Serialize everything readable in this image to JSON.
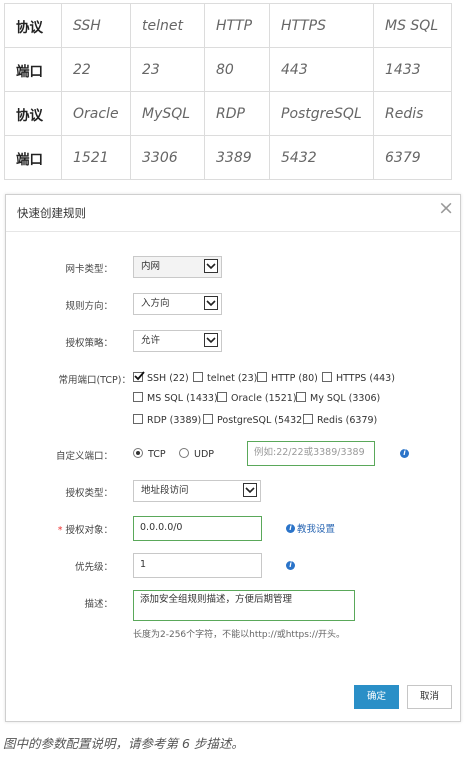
{
  "port_table": {
    "rows": [
      {
        "header": "协议",
        "cells": [
          "SSH",
          "telnet",
          "HTTP",
          "HTTPS",
          "MS SQL"
        ]
      },
      {
        "header": "端口",
        "cells": [
          "22",
          "23",
          "80",
          "443",
          "1433"
        ]
      },
      {
        "header": "协议",
        "cells": [
          "Oracle",
          "MySQL",
          "RDP",
          "PostgreSQL",
          "Redis"
        ]
      },
      {
        "header": "端口",
        "cells": [
          "1521",
          "3306",
          "3389",
          "5432",
          "6379"
        ]
      }
    ]
  },
  "dialog": {
    "title": "快速创建规则",
    "close_glyph": "×",
    "nic_type": {
      "label": "网卡类型：",
      "value": "内网"
    },
    "direction": {
      "label": "规则方向：",
      "value": "入方向"
    },
    "policy": {
      "label": "授权策略：",
      "value": "允许"
    },
    "common_ports": {
      "label": "常用端口(TCP)：",
      "options": [
        {
          "label": "SSH (22)",
          "checked": true
        },
        {
          "label": "telnet (23)",
          "checked": false
        },
        {
          "label": "HTTP (80)",
          "checked": false
        },
        {
          "label": "HTTPS (443)",
          "checked": false
        },
        {
          "label": "MS SQL (1433)",
          "checked": false
        },
        {
          "label": "Oracle (1521)",
          "checked": false
        },
        {
          "label": "My SQL (3306)",
          "checked": false
        },
        {
          "label": "RDP (3389)",
          "checked": false
        },
        {
          "label": "PostgreSQL (5432)",
          "checked": false
        },
        {
          "label": "Redis (6379)",
          "checked": false
        }
      ]
    },
    "custom_port": {
      "label": "自定义端口：",
      "protocols": [
        {
          "label": "TCP",
          "selected": true
        },
        {
          "label": "UDP",
          "selected": false
        }
      ],
      "placeholder": "例如:22/22或3389/3389"
    },
    "auth_type": {
      "label": "授权类型：",
      "value": "地址段访问"
    },
    "auth_object": {
      "required_mark": "*",
      "label": "授权对象：",
      "value": "0.0.0.0/0",
      "help_link": "教我设置"
    },
    "priority": {
      "label": "优先级：",
      "value": "1"
    },
    "description": {
      "label": "描述：",
      "value": "添加安全组规则描述，方便后期管理",
      "hint": "长度为2-256个字符，不能以http://或https://开头。"
    },
    "confirm_label": "确定",
    "cancel_label": "取消"
  },
  "caption": "图中的参数配置说明，请参考第 6 步描述。"
}
